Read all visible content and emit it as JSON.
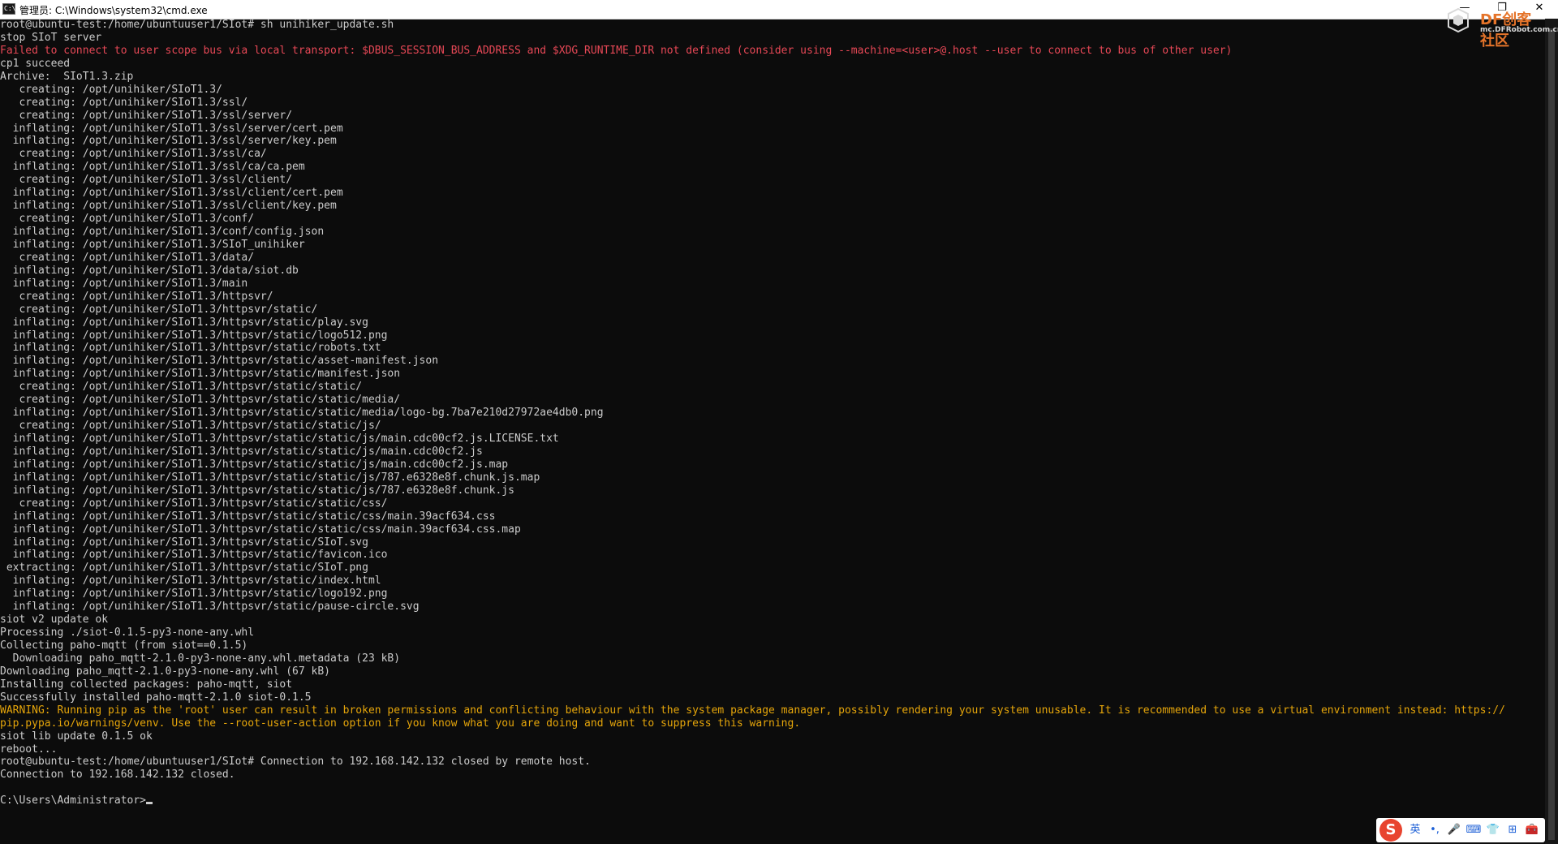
{
  "window": {
    "title": "管理员: C:\\Windows\\system32\\cmd.exe",
    "icon_label": "C:\\",
    "controls": {
      "minimize": "—",
      "restore": "❐",
      "close": "✕"
    }
  },
  "watermark": {
    "brand": "DF创客社区",
    "site": "mc.DFRobot.com.cn"
  },
  "terminal": {
    "lines": [
      {
        "text": "root@ubuntu-test:/home/ubuntuuser1/SIot# sh unihiker_update.sh",
        "style": "normal"
      },
      {
        "text": "stop SIoT server",
        "style": "normal"
      },
      {
        "text": "Failed to connect to user scope bus via local transport: $DBUS_SESSION_BUS_ADDRESS and $XDG_RUNTIME_DIR not defined (consider using --machine=<user>@.host --user to connect to bus of other user)",
        "style": "err"
      },
      {
        "text": "cp1 succeed",
        "style": "normal"
      },
      {
        "text": "Archive:  SIoT1.3.zip",
        "style": "normal"
      },
      {
        "text": "   creating: /opt/unihiker/SIoT1.3/",
        "style": "normal"
      },
      {
        "text": "   creating: /opt/unihiker/SIoT1.3/ssl/",
        "style": "normal"
      },
      {
        "text": "   creating: /opt/unihiker/SIoT1.3/ssl/server/",
        "style": "normal"
      },
      {
        "text": "  inflating: /opt/unihiker/SIoT1.3/ssl/server/cert.pem",
        "style": "normal"
      },
      {
        "text": "  inflating: /opt/unihiker/SIoT1.3/ssl/server/key.pem",
        "style": "normal"
      },
      {
        "text": "   creating: /opt/unihiker/SIoT1.3/ssl/ca/",
        "style": "normal"
      },
      {
        "text": "  inflating: /opt/unihiker/SIoT1.3/ssl/ca/ca.pem",
        "style": "normal"
      },
      {
        "text": "   creating: /opt/unihiker/SIoT1.3/ssl/client/",
        "style": "normal"
      },
      {
        "text": "  inflating: /opt/unihiker/SIoT1.3/ssl/client/cert.pem",
        "style": "normal"
      },
      {
        "text": "  inflating: /opt/unihiker/SIoT1.3/ssl/client/key.pem",
        "style": "normal"
      },
      {
        "text": "   creating: /opt/unihiker/SIoT1.3/conf/",
        "style": "normal"
      },
      {
        "text": "  inflating: /opt/unihiker/SIoT1.3/conf/config.json",
        "style": "normal"
      },
      {
        "text": "  inflating: /opt/unihiker/SIoT1.3/SIoT_unihiker",
        "style": "normal"
      },
      {
        "text": "   creating: /opt/unihiker/SIoT1.3/data/",
        "style": "normal"
      },
      {
        "text": "  inflating: /opt/unihiker/SIoT1.3/data/siot.db",
        "style": "normal"
      },
      {
        "text": "  inflating: /opt/unihiker/SIoT1.3/main",
        "style": "normal"
      },
      {
        "text": "   creating: /opt/unihiker/SIoT1.3/httpsvr/",
        "style": "normal"
      },
      {
        "text": "   creating: /opt/unihiker/SIoT1.3/httpsvr/static/",
        "style": "normal"
      },
      {
        "text": "  inflating: /opt/unihiker/SIoT1.3/httpsvr/static/play.svg",
        "style": "normal"
      },
      {
        "text": "  inflating: /opt/unihiker/SIoT1.3/httpsvr/static/logo512.png",
        "style": "normal"
      },
      {
        "text": "  inflating: /opt/unihiker/SIoT1.3/httpsvr/static/robots.txt",
        "style": "normal"
      },
      {
        "text": "  inflating: /opt/unihiker/SIoT1.3/httpsvr/static/asset-manifest.json",
        "style": "normal"
      },
      {
        "text": "  inflating: /opt/unihiker/SIoT1.3/httpsvr/static/manifest.json",
        "style": "normal"
      },
      {
        "text": "   creating: /opt/unihiker/SIoT1.3/httpsvr/static/static/",
        "style": "normal"
      },
      {
        "text": "   creating: /opt/unihiker/SIoT1.3/httpsvr/static/static/media/",
        "style": "normal"
      },
      {
        "text": "  inflating: /opt/unihiker/SIoT1.3/httpsvr/static/static/media/logo-bg.7ba7e210d27972ae4db0.png",
        "style": "normal"
      },
      {
        "text": "   creating: /opt/unihiker/SIoT1.3/httpsvr/static/static/js/",
        "style": "normal"
      },
      {
        "text": "  inflating: /opt/unihiker/SIoT1.3/httpsvr/static/static/js/main.cdc00cf2.js.LICENSE.txt",
        "style": "normal"
      },
      {
        "text": "  inflating: /opt/unihiker/SIoT1.3/httpsvr/static/static/js/main.cdc00cf2.js",
        "style": "normal"
      },
      {
        "text": "  inflating: /opt/unihiker/SIoT1.3/httpsvr/static/static/js/main.cdc00cf2.js.map",
        "style": "normal"
      },
      {
        "text": "  inflating: /opt/unihiker/SIoT1.3/httpsvr/static/static/js/787.e6328e8f.chunk.js.map",
        "style": "normal"
      },
      {
        "text": "  inflating: /opt/unihiker/SIoT1.3/httpsvr/static/static/js/787.e6328e8f.chunk.js",
        "style": "normal"
      },
      {
        "text": "   creating: /opt/unihiker/SIoT1.3/httpsvr/static/static/css/",
        "style": "normal"
      },
      {
        "text": "  inflating: /opt/unihiker/SIoT1.3/httpsvr/static/static/css/main.39acf634.css",
        "style": "normal"
      },
      {
        "text": "  inflating: /opt/unihiker/SIoT1.3/httpsvr/static/static/css/main.39acf634.css.map",
        "style": "normal"
      },
      {
        "text": "  inflating: /opt/unihiker/SIoT1.3/httpsvr/static/SIoT.svg",
        "style": "normal"
      },
      {
        "text": "  inflating: /opt/unihiker/SIoT1.3/httpsvr/static/favicon.ico",
        "style": "normal"
      },
      {
        "text": " extracting: /opt/unihiker/SIoT1.3/httpsvr/static/SIoT.png",
        "style": "normal"
      },
      {
        "text": "  inflating: /opt/unihiker/SIoT1.3/httpsvr/static/index.html",
        "style": "normal"
      },
      {
        "text": "  inflating: /opt/unihiker/SIoT1.3/httpsvr/static/logo192.png",
        "style": "normal"
      },
      {
        "text": "  inflating: /opt/unihiker/SIoT1.3/httpsvr/static/pause-circle.svg",
        "style": "normal"
      },
      {
        "text": "siot v2 update ok",
        "style": "normal"
      },
      {
        "text": "Processing ./siot-0.1.5-py3-none-any.whl",
        "style": "normal"
      },
      {
        "text": "Collecting paho-mqtt (from siot==0.1.5)",
        "style": "normal"
      },
      {
        "text": "  Downloading paho_mqtt-2.1.0-py3-none-any.whl.metadata (23 kB)",
        "style": "normal"
      },
      {
        "text": "Downloading paho_mqtt-2.1.0-py3-none-any.whl (67 kB)",
        "style": "normal"
      },
      {
        "text": "Installing collected packages: paho-mqtt, siot",
        "style": "normal"
      },
      {
        "text": "Successfully installed paho-mqtt-2.1.0 siot-0.1.5",
        "style": "normal"
      },
      {
        "text": "WARNING: Running pip as the 'root' user can result in broken permissions and conflicting behaviour with the system package manager, possibly rendering your system unusable. It is recommended to use a virtual environment instead: https://",
        "style": "warn"
      },
      {
        "text": "pip.pypa.io/warnings/venv. Use the --root-user-action option if you know what you are doing and want to suppress this warning.",
        "style": "warn"
      },
      {
        "text": "siot lib update 0.1.5 ok",
        "style": "normal"
      },
      {
        "text": "reboot...",
        "style": "normal"
      },
      {
        "text": "root@ubuntu-test:/home/ubuntuuser1/SIot# Connection to 192.168.142.132 closed by remote host.",
        "style": "normal"
      },
      {
        "text": "Connection to 192.168.142.132 closed.",
        "style": "normal"
      },
      {
        "text": "",
        "style": "normal"
      },
      {
        "text": "C:\\Users\\Administrator>",
        "style": "prompt"
      }
    ]
  },
  "ime": {
    "logo": "S",
    "mode": "英",
    "items": [
      "•,",
      "🎤",
      "⌨",
      "👕",
      "⊞",
      "🧰"
    ]
  },
  "colors": {
    "background": "#0c0c0c",
    "text": "#cccccc",
    "error": "#e74856",
    "warning": "#e5a50a"
  }
}
